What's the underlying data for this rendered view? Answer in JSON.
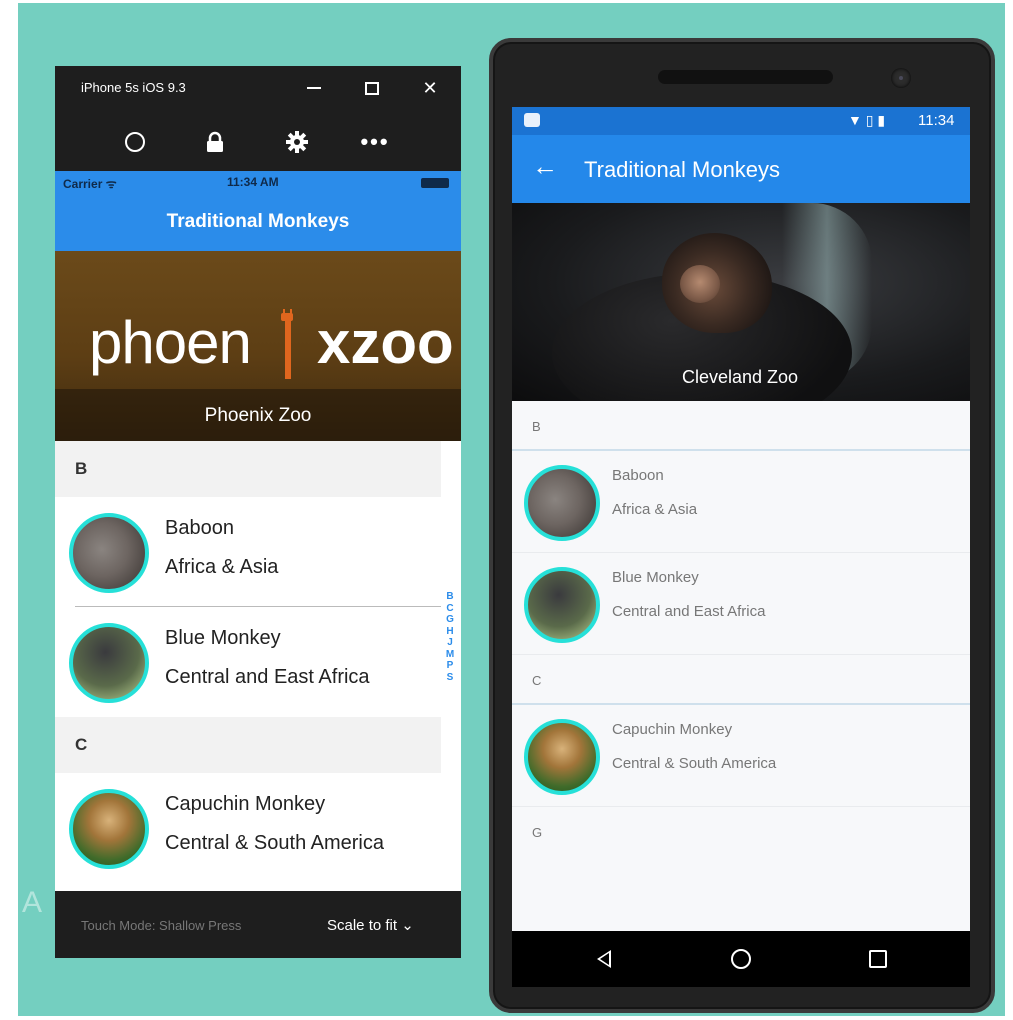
{
  "background_color": "#74cfc0",
  "partial_text": "A",
  "ios": {
    "window_title": "iPhone 5s iOS 9.3",
    "window_controls": {
      "minimize": "minimize-icon",
      "maximize": "maximize-icon",
      "close": "close-icon"
    },
    "toolbar": [
      "home-icon",
      "lock-icon",
      "settings-icon",
      "more-icon"
    ],
    "status": {
      "carrier": "Carrier ᯤ",
      "time": "11:34 AM"
    },
    "nav_title": "Traditional Monkeys",
    "hero": {
      "logo_left": "phoen",
      "logo_right": "xzoo",
      "caption": "Phoenix Zoo"
    },
    "sections": [
      {
        "label": "B",
        "rows": [
          {
            "name": "Baboon",
            "location": "Africa & Asia"
          },
          {
            "name": "Blue Monkey",
            "location": "Central and East Africa"
          }
        ]
      },
      {
        "label": "C",
        "rows": [
          {
            "name": "Capuchin Monkey",
            "location": "Central & South America"
          }
        ]
      }
    ],
    "index_letters": [
      "B",
      "C",
      "G",
      "H",
      "J",
      "M",
      "P",
      "S"
    ],
    "footer": {
      "touch_mode": "Touch Mode: Shallow Press",
      "scale": "Scale to fit ⌄"
    },
    "accent": "#2b8cea",
    "avatar_border": "#26e0d8"
  },
  "android": {
    "status": {
      "icons": "▼ ▯ ▮",
      "time": "11:34"
    },
    "toolbar_title": "Traditional Monkeys",
    "back_label": "←",
    "hero_caption": "Cleveland Zoo",
    "sections": [
      {
        "label": "B",
        "rows": [
          {
            "name": "Baboon",
            "location": "Africa & Asia"
          },
          {
            "name": "Blue Monkey",
            "location": "Central and East Africa"
          }
        ]
      },
      {
        "label": "C",
        "rows": [
          {
            "name": "Capuchin Monkey",
            "location": "Central & South America"
          }
        ]
      },
      {
        "label": "G",
        "rows": []
      }
    ],
    "nav_buttons": [
      "back-icon",
      "home-icon",
      "recents-icon"
    ],
    "toolbar_color": "#2488ea",
    "status_color": "#1b73d2"
  }
}
